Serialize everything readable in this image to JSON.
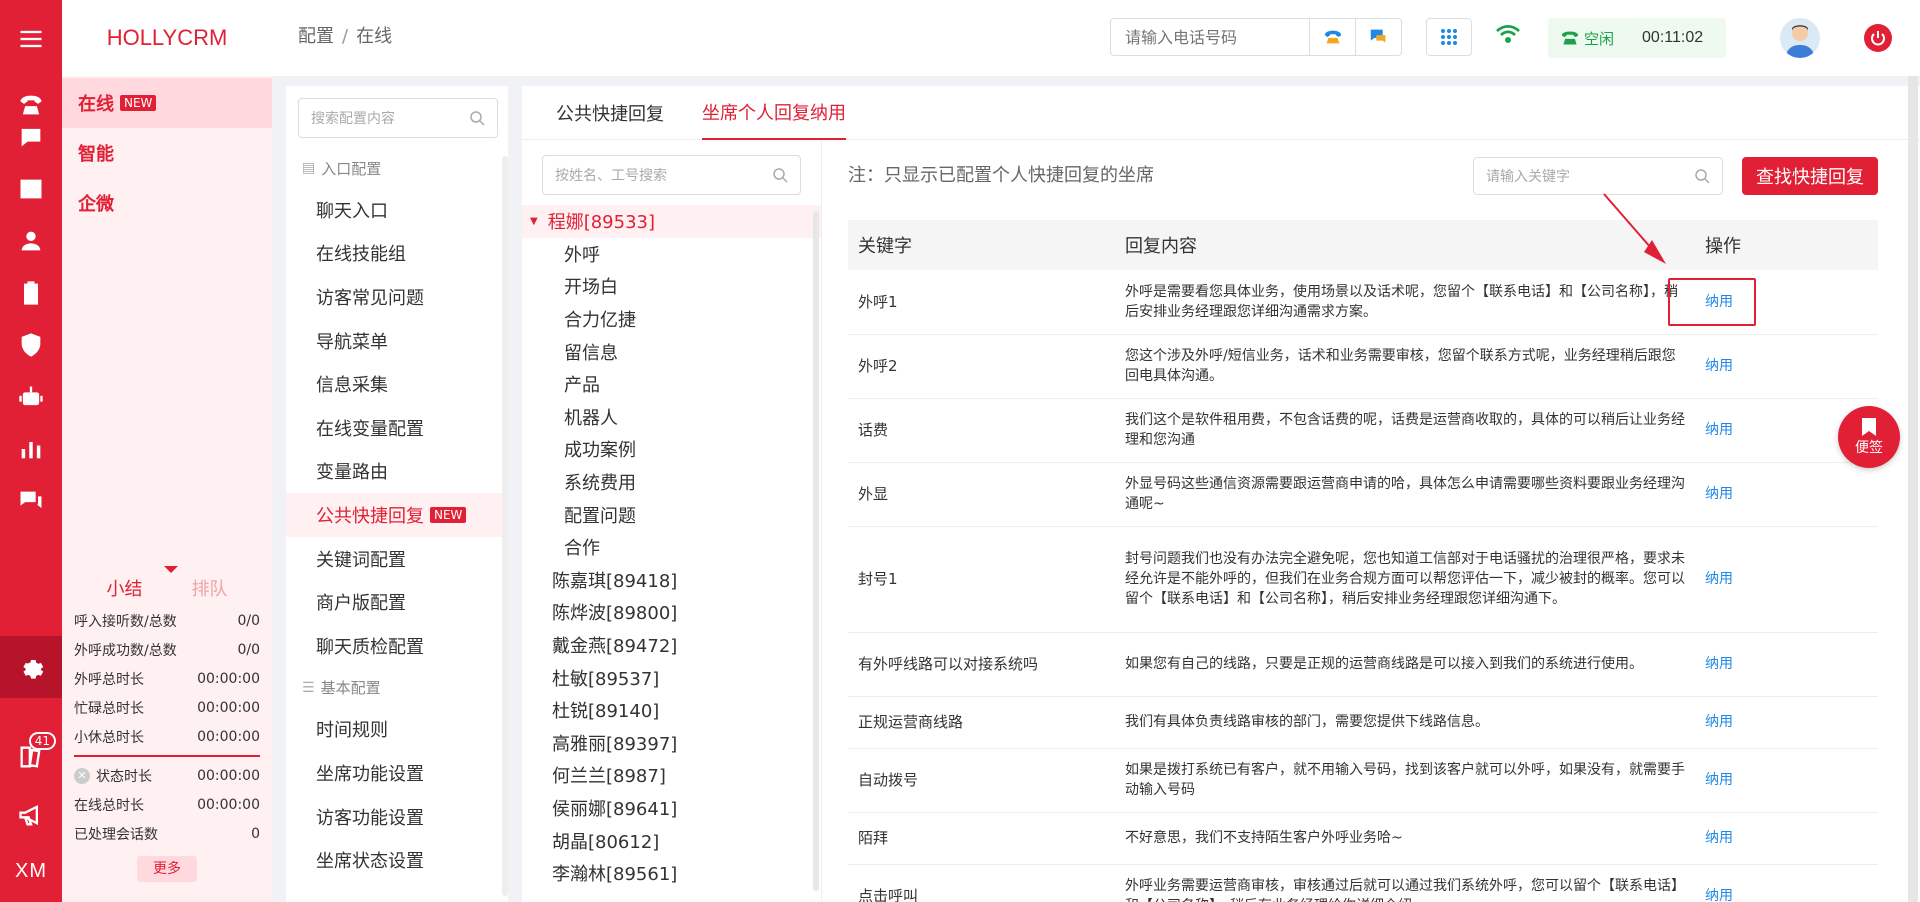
{
  "brand": "HOLLYCRM",
  "breadcrumb": {
    "root": "配置",
    "sep": "/",
    "current": "在线"
  },
  "side_nav": [
    {
      "label": "在线",
      "badge": "NEW"
    },
    {
      "label": "智能"
    },
    {
      "label": "企微"
    }
  ],
  "stats": {
    "tab1": "小结",
    "tab2": "排队",
    "rows": [
      {
        "label": "呼入接听数/总数",
        "value": "0/0"
      },
      {
        "label": "外呼成功数/总数",
        "value": "0/0"
      },
      {
        "label": "外呼总时长",
        "value": "00:00:00"
      },
      {
        "label": "忙碌总时长",
        "value": "00:00:00"
      },
      {
        "label": "小休总时长",
        "value": "00:00:00"
      }
    ],
    "rows2": [
      {
        "label": "状态时长",
        "value": "00:00:00"
      },
      {
        "label": "在线总时长",
        "value": "00:00:00"
      },
      {
        "label": "已处理会话数",
        "value": "0"
      }
    ],
    "more": "更多"
  },
  "rail": {
    "badge": "41",
    "xm": "XM"
  },
  "header": {
    "phone_placeholder": "请输入电话号码",
    "status": "空闲",
    "timer": "00:11:02"
  },
  "config": {
    "search_placeholder": "搜索配置内容",
    "group1": "入口配置",
    "items1": [
      "聊天入口",
      "在线技能组",
      "访客常见问题",
      "导航菜单",
      "信息采集",
      "在线变量配置",
      "变量路由"
    ],
    "active_item": "公共快捷回复",
    "active_badge": "NEW",
    "items1b": [
      "关键词配置",
      "商户版配置",
      "聊天质检配置"
    ],
    "group2": "基本配置",
    "items2": [
      "时间规则",
      "坐席功能设置",
      "访客功能设置",
      "坐席状态设置"
    ]
  },
  "tabs": [
    "公共快捷回复",
    "坐席个人回复纳用"
  ],
  "agents": {
    "search_placeholder": "按姓名、工号搜索",
    "open": "程娜[89533]",
    "children": [
      "外呼",
      "开场白",
      "合力亿捷",
      "留信息",
      "产品",
      "机器人",
      "成功案例",
      "系统费用",
      "配置问题",
      "合作"
    ],
    "others": [
      "陈嘉琪[89418]",
      "陈烨波[89800]",
      "戴金燕[89472]",
      "杜敏[89537]",
      "杜锐[89140]",
      "高雅丽[89397]",
      "何兰兰[8987]",
      "侯丽娜[89641]",
      "胡晶[80612]",
      "李瀚林[89561]"
    ]
  },
  "content": {
    "note": "注：只显示已配置个人快捷回复的坐席",
    "kw_placeholder": "请输入关键字",
    "find_btn": "查找快捷回复",
    "columns": [
      "关键字",
      "回复内容",
      "操作"
    ],
    "rows": [
      {
        "kw": "外呼1",
        "reply": "外呼是需要看您具体业务，使用场景以及话术呢，您留个【联系电话】和【公司名称】，稍后安排业务经理跟您详细沟通需求方案。",
        "op": "纳用"
      },
      {
        "kw": "外呼2",
        "reply": "您这个涉及外呼/短信业务，话术和业务需要审核，您留个联系方式呢，业务经理稍后跟您回电具体沟通。",
        "op": "纳用"
      },
      {
        "kw": "话费",
        "reply": "我们这个是软件租用费，不包含话费的呢，话费是运营商收取的，具体的可以稍后让业务经理和您沟通",
        "op": "纳用"
      },
      {
        "kw": "外显",
        "reply": "外显号码这些通信资源需要跟运营商申请的哈，具体怎么申请需要哪些资料要跟业务经理沟通呢~",
        "op": "纳用"
      },
      {
        "kw": "封号1",
        "reply": "封号问题我们也没有办法完全避免呢，您也知道工信部对于电话骚扰的治理很严格，要求未经允许是不能外呼的，但我们在业务合规方面可以帮您评估一下，减少被封的概率。您可以留个【联系电话】和【公司名称】，稍后安排业务经理跟您详细沟通下。",
        "op": "纳用"
      },
      {
        "kw": "有外呼线路可以对接系统吗",
        "reply": "如果您有自己的线路，只要是正规的运营商线路是可以接入到我们的系统进行使用。",
        "op": "纳用"
      },
      {
        "kw": "正规运营商线路",
        "reply": "我们有具体负责线路审核的部门，需要您提供下线路信息。",
        "op": "纳用"
      },
      {
        "kw": "自动拨号",
        "reply": "如果是拨打系统已有客户，就不用输入号码，找到该客户就可以外呼，如果没有，就需要手动输入号码",
        "op": "纳用"
      },
      {
        "kw": "陌拜",
        "reply": "不好意思，我们不支持陌生客户外呼业务哈~",
        "op": "纳用"
      },
      {
        "kw": "点击呼叫",
        "reply": "外呼业务需要运营商审核，审核通过后就可以通过我们系统外呼，您可以留个【联系电话】和【公司名称】，稍后有业务经理给你详细介绍",
        "op": "纳用"
      }
    ]
  },
  "sticky": "便签",
  "colors": {
    "accent": "#e11f35",
    "link": "#1e88e5",
    "status": "#1aa34a"
  }
}
